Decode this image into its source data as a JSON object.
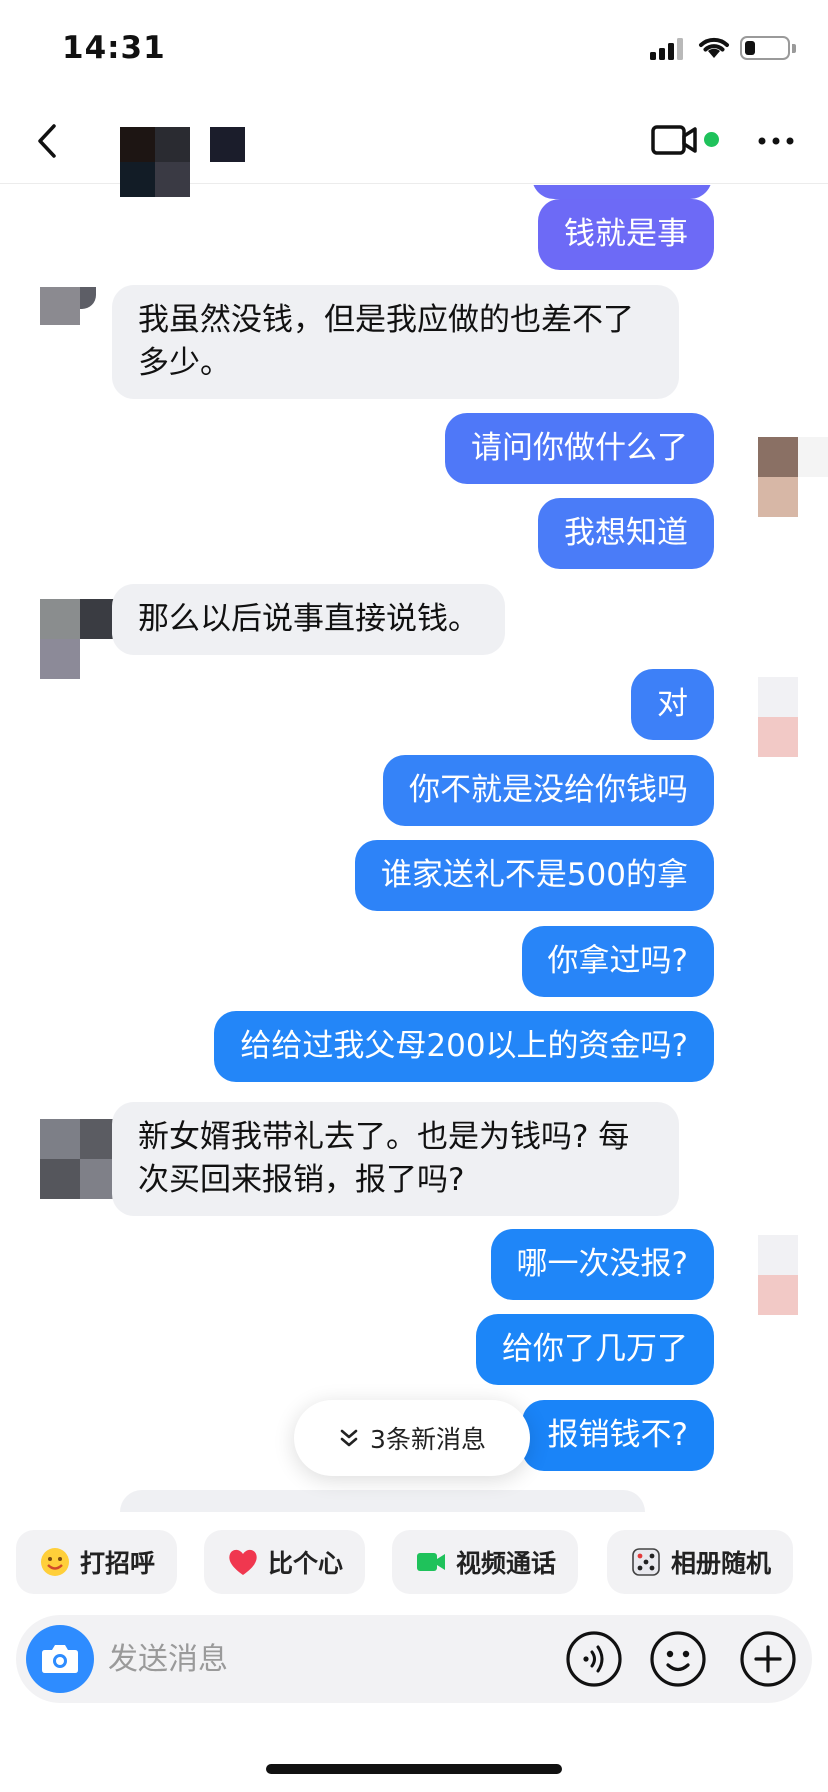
{
  "status_bar": {
    "time": "14:31"
  },
  "header": {
    "contact_name": ""
  },
  "messages": [
    {
      "text": "钱就是事",
      "side": "out"
    },
    {
      "text": "我虽然没钱，但是我应做的也差不了多少。",
      "side": "in"
    },
    {
      "text": "请问你做什么了",
      "side": "out"
    },
    {
      "text": "我想知道",
      "side": "out"
    },
    {
      "text": "那么以后说事直接说钱。",
      "side": "in"
    },
    {
      "text": "对",
      "side": "out"
    },
    {
      "text": "你不就是没给你钱吗",
      "side": "out"
    },
    {
      "text": "谁家送礼不是500的拿",
      "side": "out"
    },
    {
      "text": "你拿过吗?",
      "side": "out"
    },
    {
      "text": "给给过我父母200以上的资金吗?",
      "side": "out"
    },
    {
      "text": "新女婿我带礼去了。也是为钱吗? 每次买回来报销，报了吗?",
      "side": "in"
    },
    {
      "text": "哪一次没报?",
      "side": "out"
    },
    {
      "text": "给你了几万了",
      "side": "out"
    },
    {
      "text": "报销钱不?",
      "side": "out"
    }
  ],
  "new_messages": {
    "label": "3条新消息"
  },
  "quick_actions": [
    {
      "label": "打招呼",
      "icon": "greeting-icon"
    },
    {
      "label": "比个心",
      "icon": "heart-icon"
    },
    {
      "label": "视频通话",
      "icon": "video-icon"
    },
    {
      "label": "相册随机",
      "icon": "dice-icon"
    }
  ],
  "input": {
    "placeholder": "发送消息"
  },
  "colors": {
    "out_bubble_top": "#6b6af6",
    "out_bubble_bottom": "#1a84f8",
    "in_bubble": "#eff0f3",
    "accent": "#2e8cff",
    "online": "#1fc25b"
  }
}
